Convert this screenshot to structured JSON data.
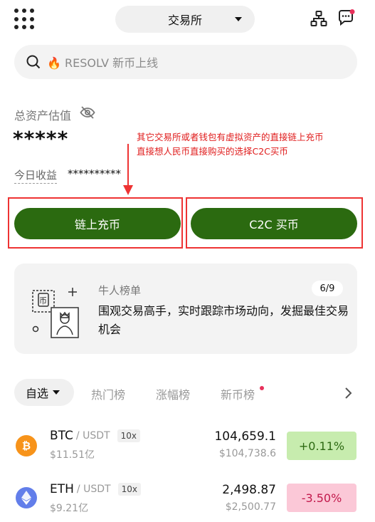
{
  "header": {
    "exchange_toggle_label": "交易所",
    "search_placeholder": "🔥 RESOLV 新币上线"
  },
  "assets": {
    "title": "总资产估值",
    "masked_value": "*****",
    "today_label": "今日收益",
    "today_masked_value": "**********"
  },
  "annotation": {
    "line1": "其它交易所或者钱包有虚拟资产的直接链上充币",
    "line2": "直接想人民币直接购买的选择C2C买币",
    "color": "#e01c1c"
  },
  "actions": {
    "onchain_deposit_label": "链上充币",
    "c2c_buy_label": "C2C 买币",
    "button_color": "#2b6a10"
  },
  "leaderboard_card": {
    "title": "牛人榜单",
    "badge": "6/9",
    "text": "围观交易高手，实时跟踪市场动向，发掘最佳交易机会"
  },
  "market_tabs": [
    {
      "label": "自选",
      "active": true
    },
    {
      "label": "热门榜",
      "active": false
    },
    {
      "label": "涨幅榜",
      "active": false
    },
    {
      "label": "新币榜",
      "active": false,
      "dot": true
    }
  ],
  "coins": [
    {
      "symbol": "BTC",
      "quote": "/ USDT",
      "leverage": "10x",
      "volume": "$11.51亿",
      "price": "104,659.1",
      "price_usd": "$104,738.6",
      "change": "+0.11%",
      "direction": "up",
      "icon": "bitcoin-icon",
      "icon_color": "#f7931a"
    },
    {
      "symbol": "ETH",
      "quote": "/ USDT",
      "leverage": "10x",
      "volume": "$9.21亿",
      "price": "2,498.87",
      "price_usd": "$2,500.77",
      "change": "-3.50%",
      "direction": "down",
      "icon": "ethereum-icon",
      "icon_color": "#627eea"
    }
  ]
}
